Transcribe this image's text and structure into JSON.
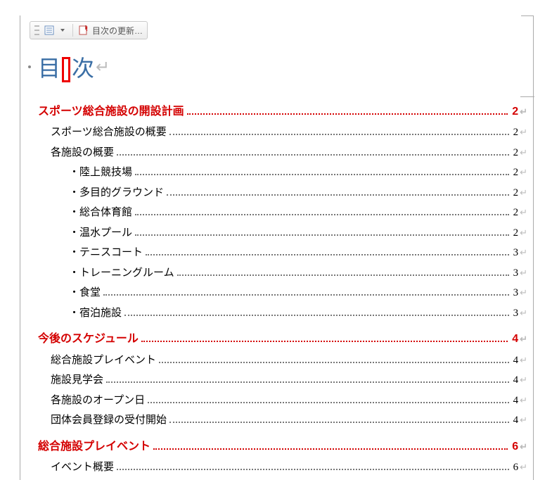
{
  "toolbar": {
    "update_label": "目次の更新…"
  },
  "title": {
    "pre": "目",
    "post": "次"
  },
  "toc": [
    {
      "level": 1,
      "text": "スポーツ総合施設の開設計画",
      "page": "2"
    },
    {
      "level": 2,
      "text": "スポーツ総合施設の概要",
      "page": "2"
    },
    {
      "level": 2,
      "text": "各施設の概要",
      "page": "2"
    },
    {
      "level": 3,
      "text": "陸上競技場",
      "page": "2"
    },
    {
      "level": 3,
      "text": "多目的グラウンド",
      "page": "2"
    },
    {
      "level": 3,
      "text": "総合体育館",
      "page": "2"
    },
    {
      "level": 3,
      "text": "温水プール",
      "page": "2"
    },
    {
      "level": 3,
      "text": "テニスコート",
      "page": "3"
    },
    {
      "level": 3,
      "text": "トレーニングルーム",
      "page": "3"
    },
    {
      "level": 3,
      "text": "食堂",
      "page": "3"
    },
    {
      "level": 3,
      "text": "宿泊施設",
      "page": "3"
    },
    {
      "level": 1,
      "text": "今後のスケジュール",
      "page": "4"
    },
    {
      "level": 2,
      "text": "総合施設プレイベント",
      "page": "4"
    },
    {
      "level": 2,
      "text": "施設見学会",
      "page": "4"
    },
    {
      "level": 2,
      "text": "各施設のオープン日",
      "page": "4"
    },
    {
      "level": 2,
      "text": "団体会員登録の受付開始",
      "page": "4"
    },
    {
      "level": 1,
      "text": "総合施設プレイベント",
      "page": "6"
    },
    {
      "level": 2,
      "text": "イベント概要",
      "page": "6"
    }
  ]
}
